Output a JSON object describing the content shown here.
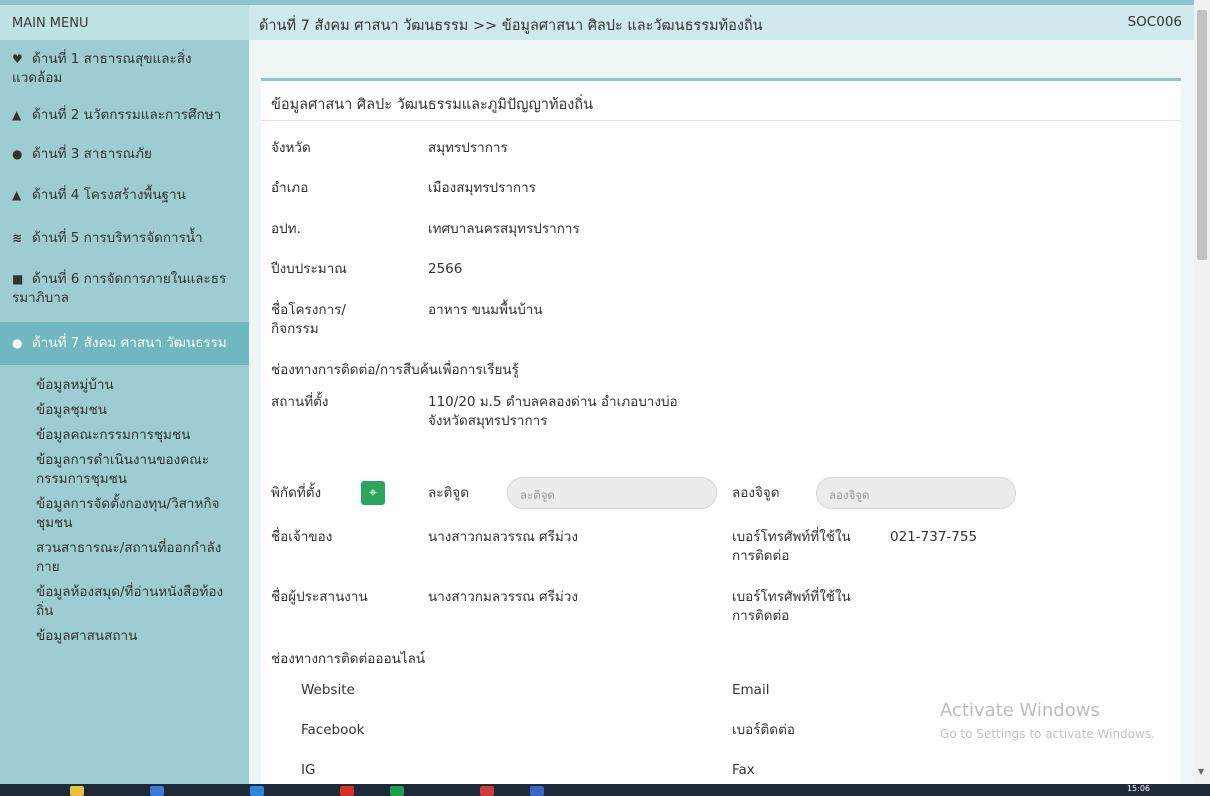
{
  "sidebar": {
    "header": "MAIN MENU",
    "items": [
      {
        "icon": "♥",
        "label": "ด้านที่ 1 สาธารณสุขและสิ่งแวดล้อม"
      },
      {
        "icon": "▲",
        "label": "ด้านที่ 2 นวัตกรรมและการศึกษา"
      },
      {
        "icon": "●",
        "label": "ด้านที่ 3 สาธารณภัย"
      },
      {
        "icon": "▲",
        "label": "ด้านที่ 4 โครงสร้างพื้นฐาน"
      },
      {
        "icon": "≋",
        "label": "ด้านที่ 5 การบริหารจัดการน้ำ"
      },
      {
        "icon": "■",
        "label": "ด้านที่ 6 การจัดการภายในและธรรมาภิบาล"
      },
      {
        "icon": "●",
        "label": "ด้านที่ 7 สังคม ศาสนา วัฒนธรรม"
      }
    ],
    "subitems": [
      "ข้อมูลหมู่บ้าน",
      "ข้อมูลชุมชน",
      "ข้อมูลคณะกรรมการชุมชน",
      "ข้อมูลการดำเนินงานของคณะกรรมการชุมชน",
      "ข้อมูลการจัดตั้งกองทุน/วิสาหกิจชุมชน",
      "สวนสาธารณะ/สถานที่ออกกำลังกาย",
      "ข้อมูลห้องสมุด/ที่อ่านหนังสือท้องถิ่น",
      "ข้อมูลศาสนสถาน"
    ]
  },
  "header": {
    "breadcrumb": "ด้านที่ 7 สังคม ศาสนา วัฒนธรรม >>  ข้อมูลศาสนา ศิลปะ และวัฒนธรรมท้องถิ่น",
    "code": "SOC006"
  },
  "card": {
    "title": "ข้อมูลศาสนา ศิลปะ วัฒนธรรมและภูมิปัญญาท้องถิ่น",
    "fields": {
      "province_label": "จังหวัด",
      "province": "สมุทรปราการ",
      "district_label": "อำเภอ",
      "district": "เมืองสมุทรปราการ",
      "lao_label": "อปท.",
      "lao": "เทศบาลนครสมุทรปราการ",
      "year_label": "ปีงบประมาณ",
      "year": "2566",
      "project_label": "ชื่อโครงการ/กิจกรรม",
      "project": "อาหาร ขนมพื้นบ้าน",
      "contact_section": "ช่องทางการติดต่อ/การสืบค้นเพื่อการเรียนรู้",
      "location_label": "สถานที่ตั้ง",
      "location": "110/20 ม.5 ตำบลคลองด่าน อำเภอบางบ่อ จังหวัดสมุทรปราการ",
      "coords_label": "พิกัดที่ตั้ง",
      "lat_label": "ละติจูด",
      "lat_placeholder": "ละติจูด",
      "lng_label": "ลองจิจูด",
      "lng_placeholder": "ลองจิจูด",
      "owner_label": "ชื่อเจ้าของ",
      "owner": "นางสาวกมลวรรณ ศรีม่วง",
      "phone_label": "เบอร์โทรศัพท์ที่ใช้ในการติดต่อ",
      "phone": "021-737-755",
      "coordinator_label": "ชื่อผู้ประสานงาน",
      "coordinator": "นางสาวกมลวรรณ ศรีม่วง",
      "phone2_label": "เบอร์โทรศัพท์ที่ใช้ในการติดต่อ",
      "online_section": "ช่องทางการติดต่อออนไลน์",
      "website_label": "Website",
      "email_label": "Email",
      "facebook_label": "Facebook",
      "contact_phone_label": "เบอร์ติดต่อ",
      "ig_label": "IG",
      "fax_label": "Fax"
    }
  },
  "watermark": {
    "line1": "Activate Windows",
    "line2": "Go to Settings to activate Windows."
  },
  "taskbar": {
    "clock": "15:06"
  },
  "colors": {
    "sidebar": "#9dcdd3",
    "active": "#6fb8c0",
    "header": "#cfe9ec",
    "map_button": "#2aa65c"
  }
}
